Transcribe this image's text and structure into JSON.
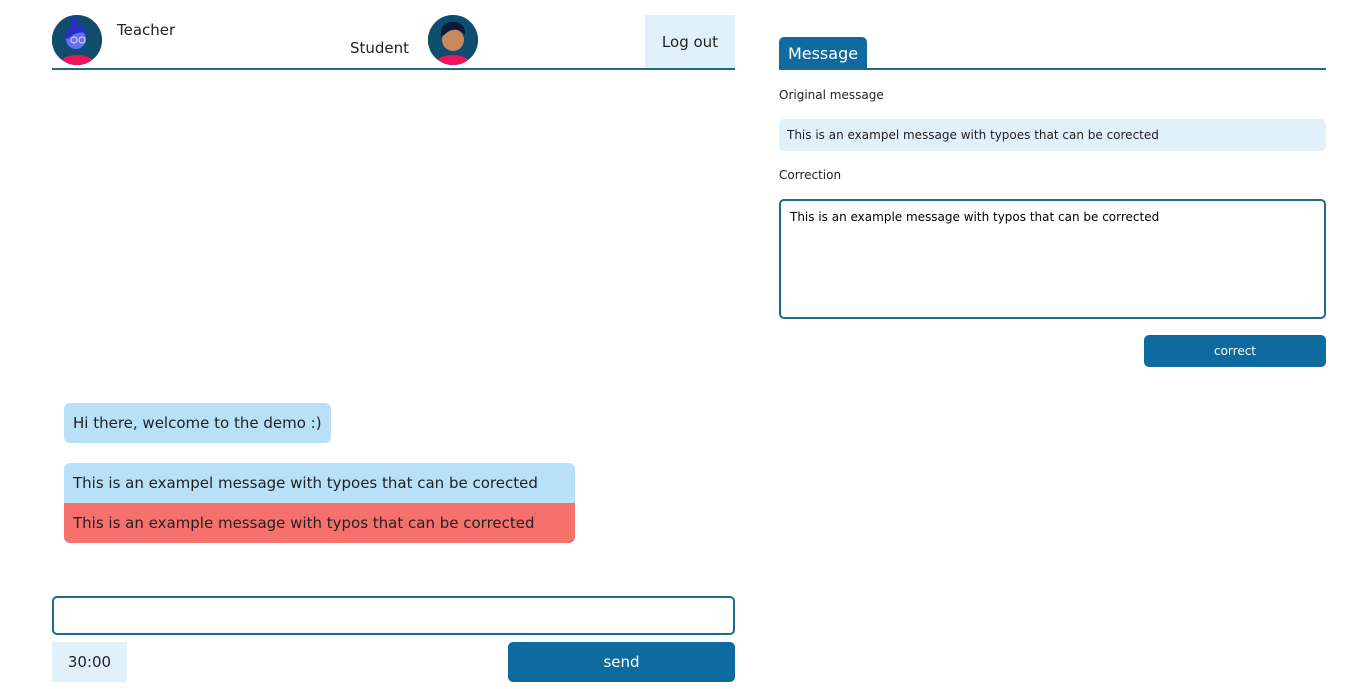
{
  "header": {
    "teacher_label": "Teacher",
    "student_label": "Student",
    "logout_label": "Log out"
  },
  "chat": {
    "messages": [
      {
        "text": "Hi there, welcome to the demo :)"
      },
      {
        "text": "This is an exampel message with typoes that can be corected"
      },
      {
        "text": "This is an example message with typos that can be corrected"
      }
    ],
    "input_value": "",
    "timer": "30:00",
    "send_label": "send"
  },
  "panel": {
    "tab_label": "Message",
    "original_label": "Original message",
    "original_value": "This is an exampel message with typoes that can be corected",
    "correction_label": "Correction",
    "correction_value": "This is an example message with typos that can be corrected",
    "correct_label": "correct"
  },
  "colors": {
    "primary": "#0f6aa0",
    "light": "#e1f1fc",
    "bubble": "#b8e1f8",
    "correction": "#f7716c"
  }
}
